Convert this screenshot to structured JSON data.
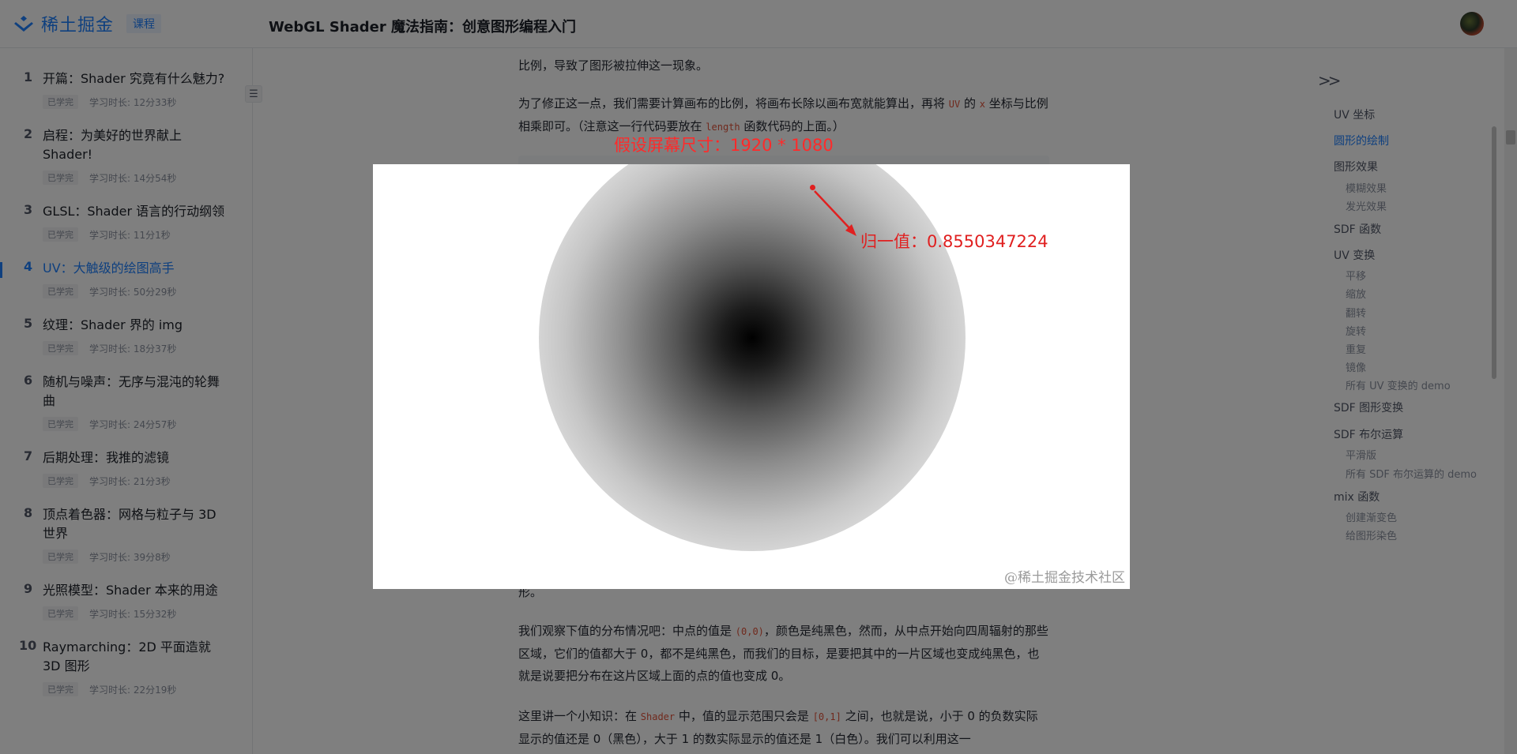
{
  "header": {
    "logo_text": "稀土掘金",
    "badge": "课程",
    "course_title": "WebGL Shader 魔法指南：创意图形编程入门"
  },
  "sidebar": {
    "chapters": [
      {
        "num": "1",
        "title": "开篇：Shader 究竟有什么魅力?",
        "tag": "已学完",
        "duration": "学习时长: 12分33秒"
      },
      {
        "num": "2",
        "title": "启程：为美好的世界献上 Shader!",
        "tag": "已学完",
        "duration": "学习时长: 14分54秒"
      },
      {
        "num": "3",
        "title": "GLSL：Shader 语言的行动纲领",
        "tag": "已学完",
        "duration": "学习时长: 11分1秒"
      },
      {
        "num": "4",
        "title": "UV：大触级的绘图高手",
        "tag": "已学完",
        "duration": "学习时长: 50分29秒"
      },
      {
        "num": "5",
        "title": "纹理：Shader 界的 img",
        "tag": "已学完",
        "duration": "学习时长: 18分37秒"
      },
      {
        "num": "6",
        "title": "随机与噪声：无序与混沌的轮舞曲",
        "tag": "已学完",
        "duration": "学习时长: 24分57秒"
      },
      {
        "num": "7",
        "title": "后期处理：我推的滤镜",
        "tag": "已学完",
        "duration": "学习时长: 21分3秒"
      },
      {
        "num": "8",
        "title": "顶点着色器：网格与粒子与 3D 世界",
        "tag": "已学完",
        "duration": "学习时长: 39分8秒"
      },
      {
        "num": "9",
        "title": "光照模型：Shader 本来的用途",
        "tag": "已学完",
        "duration": "学习时长: 15分32秒"
      },
      {
        "num": "10",
        "title": "Raymarching：2D 平面造就 3D 图形",
        "tag": "已学完",
        "duration": "学习时长: 22分19秒"
      }
    ]
  },
  "content": {
    "p1": "比例，导致了图形被拉伸这一现象。",
    "p2_a": "为了修正这一点，我们需要计算画布的比例，将画布长除以画布宽就能算出，再将 ",
    "p2_code1": "UV",
    "p2_b": " 的 ",
    "p2_code2": "x",
    "p2_c": " 坐标与比例相乘即可。（注意这一行代码要放在 ",
    "p2_code3": "length",
    "p2_d": " 函数代码的上面。）",
    "p3_tail": "形。",
    "p4_a": "我们观察下值的分布情况吧：中点的值是 ",
    "p4_code1": "(0,0)",
    "p4_b": "，颜色是纯黑色，然而，从中点开始向四周辐射的那些区域，它们的值都大于 0，都不是纯黑色，而我们的目标，是要把其中的一片区域也变成纯黑色，也就是说要把分布在这片区域上面的点的值也变成 0。",
    "p5_a": "这里讲一个小知识：在 ",
    "p5_code1": "Shader",
    "p5_b": " 中，值的显示范围只会是 ",
    "p5_code2": "[0,1]",
    "p5_c": " 之间，也就是说，小于 0 的负数实际显示的值还是 0（黑色），大于 1 的数实际显示的值还是 1（白色）。我们可以利用这一"
  },
  "toc": {
    "items": [
      {
        "label": "UV 坐标",
        "level": 1
      },
      {
        "label": "圆形的绘制",
        "level": 1,
        "active": true
      },
      {
        "label": "图形效果",
        "level": 1
      },
      {
        "label": "模糊效果",
        "level": 2
      },
      {
        "label": "发光效果",
        "level": 2
      },
      {
        "label": "SDF 函数",
        "level": 1
      },
      {
        "label": "UV 变换",
        "level": 1
      },
      {
        "label": "平移",
        "level": 2
      },
      {
        "label": "缩放",
        "level": 2
      },
      {
        "label": "翻转",
        "level": 2
      },
      {
        "label": "旋转",
        "level": 2
      },
      {
        "label": "重复",
        "level": 2
      },
      {
        "label": "镜像",
        "level": 2
      },
      {
        "label": "所有 UV 变换的 demo",
        "level": 2
      },
      {
        "label": "SDF 图形变换",
        "level": 1
      },
      {
        "label": "SDF 布尔运算",
        "level": 1
      },
      {
        "label": "平滑版",
        "level": 2
      },
      {
        "label": "所有 SDF 布尔运算的 demo",
        "level": 2
      },
      {
        "label": "mix 函数",
        "level": 1
      },
      {
        "label": "创建渐变色",
        "level": 2
      },
      {
        "label": "给图形染色",
        "level": 2
      }
    ]
  },
  "viewer": {
    "screen_label": "假设屏幕尺寸：1920 * 1080",
    "annotation": "归一值：0.8550347224",
    "watermark": "@稀土掘金技术社区",
    "annotation_color": "#e02020"
  },
  "colors": {
    "accent": "#1e80ff"
  }
}
